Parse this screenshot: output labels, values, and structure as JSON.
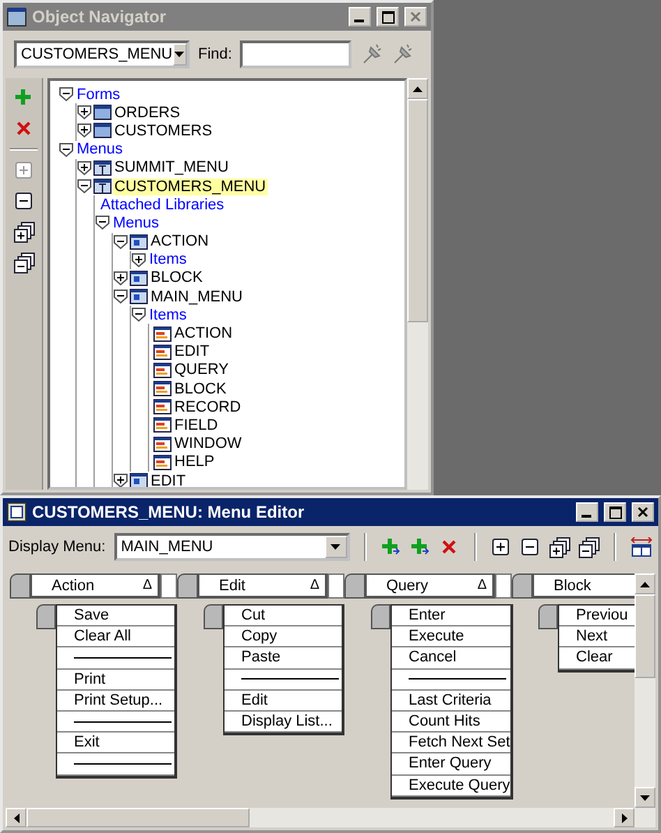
{
  "navigator": {
    "title": "Object Navigator",
    "module_select": {
      "value": "CUSTOMERS_MENU"
    },
    "find": {
      "label": "Find:"
    },
    "tree": [
      {
        "label": "Forms",
        "kind": "category",
        "expanded": true,
        "selected": false,
        "children": [
          {
            "label": "ORDERS",
            "kind": "form",
            "expanded": false,
            "selected": false
          },
          {
            "label": "CUSTOMERS",
            "kind": "form",
            "expanded": false,
            "selected": false
          }
        ]
      },
      {
        "label": "Menus",
        "kind": "category",
        "expanded": true,
        "selected": false,
        "children": [
          {
            "label": "SUMMIT_MENU",
            "kind": "module",
            "expanded": false,
            "selected": false
          },
          {
            "label": "CUSTOMERS_MENU",
            "kind": "module",
            "expanded": true,
            "selected": true,
            "children": [
              {
                "label": "Attached Libraries",
                "kind": "category",
                "selected": false
              },
              {
                "label": "Menus",
                "kind": "category",
                "expanded": true,
                "selected": false,
                "children": [
                  {
                    "label": "ACTION",
                    "kind": "menu",
                    "expanded": true,
                    "selected": false,
                    "children": [
                      {
                        "label": "Items",
                        "kind": "category",
                        "expanded": false,
                        "selected": false
                      }
                    ]
                  },
                  {
                    "label": "BLOCK",
                    "kind": "menu",
                    "expanded": false,
                    "selected": false
                  },
                  {
                    "label": "MAIN_MENU",
                    "kind": "menu",
                    "expanded": true,
                    "selected": false,
                    "children": [
                      {
                        "label": "Items",
                        "kind": "category",
                        "expanded": true,
                        "selected": false,
                        "children": [
                          {
                            "label": "ACTION",
                            "kind": "item",
                            "selected": false
                          },
                          {
                            "label": "EDIT",
                            "kind": "item",
                            "selected": false
                          },
                          {
                            "label": "QUERY",
                            "kind": "item",
                            "selected": false
                          },
                          {
                            "label": "BLOCK",
                            "kind": "item",
                            "selected": false
                          },
                          {
                            "label": "RECORD",
                            "kind": "item",
                            "selected": false
                          },
                          {
                            "label": "FIELD",
                            "kind": "item",
                            "selected": false
                          },
                          {
                            "label": "WINDOW",
                            "kind": "item",
                            "selected": false
                          },
                          {
                            "label": "HELP",
                            "kind": "item",
                            "selected": false
                          }
                        ]
                      }
                    ]
                  },
                  {
                    "label": "EDIT",
                    "kind": "menu",
                    "expanded": false,
                    "selected": false
                  }
                ]
              }
            ]
          }
        ]
      }
    ]
  },
  "editor": {
    "title": "CUSTOMERS_MENU: Menu Editor",
    "display_menu": {
      "label": "Display Menu:",
      "value": "MAIN_MENU"
    },
    "columns": [
      {
        "title": "Action",
        "marker": "Δ",
        "items": [
          {
            "kind": "item",
            "label": "Save"
          },
          {
            "kind": "item",
            "label": "Clear All"
          },
          {
            "kind": "separator"
          },
          {
            "kind": "item",
            "label": "Print"
          },
          {
            "kind": "item",
            "label": "Print Setup..."
          },
          {
            "kind": "separator"
          },
          {
            "kind": "item",
            "label": "Exit"
          },
          {
            "kind": "separator"
          }
        ]
      },
      {
        "title": "Edit",
        "marker": "Δ",
        "items": [
          {
            "kind": "item",
            "label": "Cut"
          },
          {
            "kind": "item",
            "label": "Copy"
          },
          {
            "kind": "item",
            "label": "Paste"
          },
          {
            "kind": "separator"
          },
          {
            "kind": "item",
            "label": "Edit"
          },
          {
            "kind": "item",
            "label": "Display List..."
          }
        ]
      },
      {
        "title": "Query",
        "marker": "Δ",
        "items": [
          {
            "kind": "item",
            "label": "Enter"
          },
          {
            "kind": "item",
            "label": "Execute"
          },
          {
            "kind": "item",
            "label": "Cancel"
          },
          {
            "kind": "separator"
          },
          {
            "kind": "item",
            "label": "Last Criteria"
          },
          {
            "kind": "item",
            "label": "Count Hits"
          },
          {
            "kind": "item",
            "label": "Fetch Next Set"
          },
          {
            "kind": "item",
            "label": "Enter Query"
          },
          {
            "kind": "item",
            "label": "Execute Query"
          }
        ]
      },
      {
        "title": "Block",
        "items": [
          {
            "kind": "item",
            "label": "Previou"
          },
          {
            "kind": "item",
            "label": "Next"
          },
          {
            "kind": "item",
            "label": "Clear"
          }
        ]
      }
    ]
  }
}
